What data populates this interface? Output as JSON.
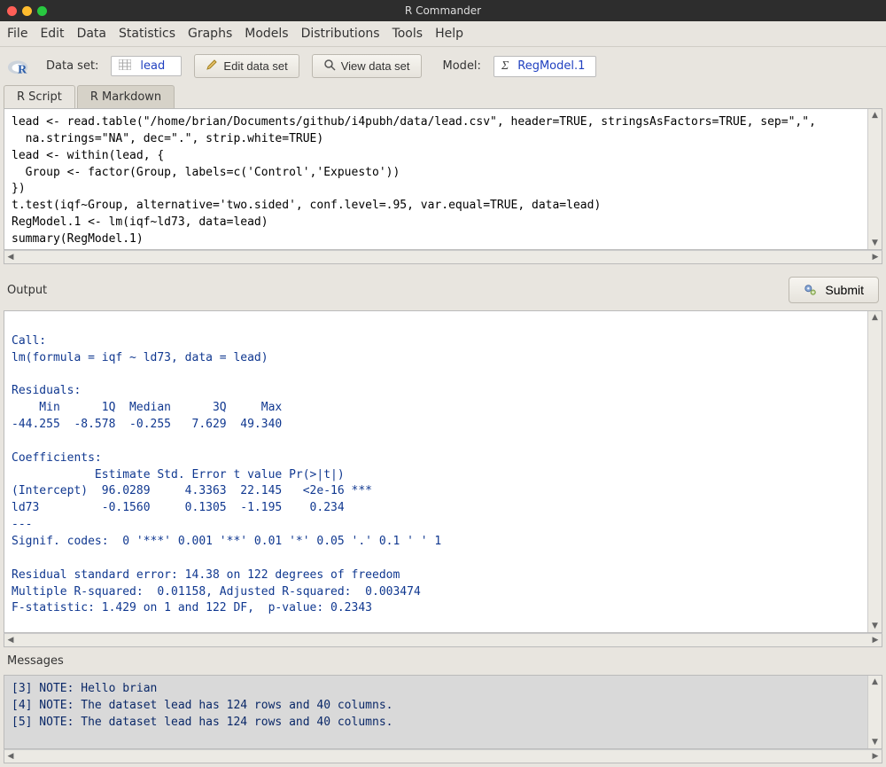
{
  "window": {
    "title": "R Commander"
  },
  "menu": {
    "items": [
      "File",
      "Edit",
      "Data",
      "Statistics",
      "Graphs",
      "Models",
      "Distributions",
      "Tools",
      "Help"
    ]
  },
  "toolbar": {
    "dataset_label": "Data set:",
    "dataset_value": "lead",
    "edit_btn": "Edit data set",
    "view_btn": "View data set",
    "model_label": "Model:",
    "model_value": "RegModel.1"
  },
  "tabs": {
    "items": [
      "R Script",
      "R Markdown"
    ],
    "active_index": 1
  },
  "script_text": "lead <- read.table(\"/home/brian/Documents/github/i4pubh/data/lead.csv\", header=TRUE, stringsAsFactors=TRUE, sep=\",\",\n  na.strings=\"NA\", dec=\".\", strip.white=TRUE)\nlead <- within(lead, {\n  Group <- factor(Group, labels=c('Control','Expuesto'))\n})\nt.test(iqf~Group, alternative='two.sided', conf.level=.95, var.equal=TRUE, data=lead)\nRegModel.1 <- lm(iqf~ld73, data=lead)\nsummary(RegModel.1)",
  "output": {
    "label": "Output",
    "submit_label": "Submit",
    "text": "\nCall:\nlm(formula = iqf ~ ld73, data = lead)\n\nResiduals:\n    Min      1Q  Median      3Q     Max \n-44.255  -8.578  -0.255   7.629  49.340 \n\nCoefficients:\n            Estimate Std. Error t value Pr(>|t|)    \n(Intercept)  96.0289     4.3363  22.145   <2e-16 ***\nld73         -0.1560     0.1305  -1.195    0.234    \n---\nSignif. codes:  0 '***' 0.001 '**' 0.01 '*' 0.05 '.' 0.1 ' ' 1\n\nResidual standard error: 14.38 on 122 degrees of freedom\nMultiple R-squared:  0.01158, Adjusted R-squared:  0.003474 \nF-statistic: 1.429 on 1 and 122 DF,  p-value: 0.2343\n"
  },
  "messages": {
    "label": "Messages",
    "text": "[3] NOTE: Hello brian\n[4] NOTE: The dataset lead has 124 rows and 40 columns.\n[5] NOTE: The dataset lead has 124 rows and 40 columns."
  }
}
